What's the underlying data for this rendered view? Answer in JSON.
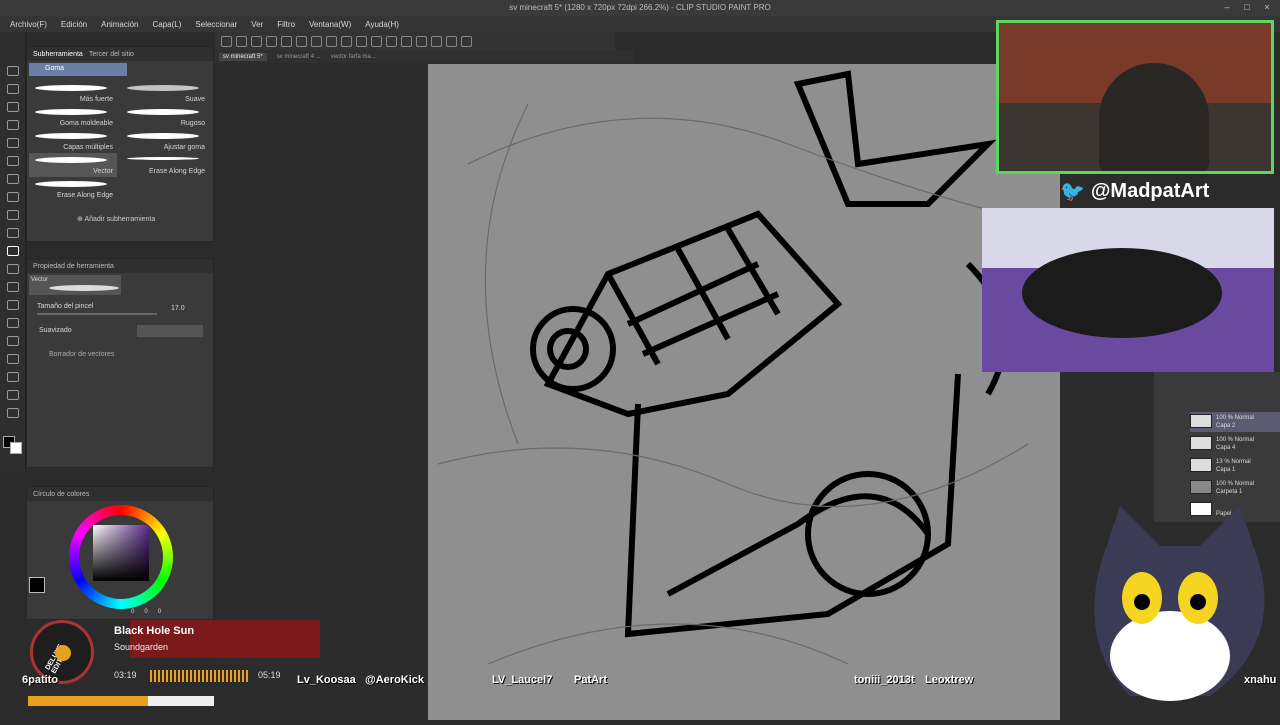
{
  "app": {
    "window_title": "sv minecraft 5* (1280 x 720px 72dpi 266.2%)  - CLIP STUDIO PAINT PRO"
  },
  "menu": [
    "Archivo(F)",
    "Edición",
    "Animación",
    "Capa(L)",
    "Seleccionar",
    "Ver",
    "Filtro",
    "Ventana(W)",
    "Ayuda(H)"
  ],
  "document_tabs": [
    "sv minecraft 5*",
    "sv minecraft 4 ...",
    "vector farfa ma..."
  ],
  "subtool_panel": {
    "tabs": [
      "Subherramienta",
      "Tercer del sitio"
    ],
    "group": "Goma",
    "brushes": [
      "Más fuerte",
      "Suave",
      "Goma moldeable",
      "Rugoso",
      "Capas múltiples",
      "Ajustar goma",
      "Vector",
      "Erase Along Edge",
      "Erase Along Edge"
    ],
    "add_label": "Añadir subherramienta"
  },
  "tool_property": {
    "title": "Propiedad de herramienta",
    "tag": "Vector",
    "brush_size_label": "Tamaño del pincel",
    "brush_size_value": "17.0",
    "smoothing_label": "Suavizado",
    "vector_eraser_label": "Borrador de vectores"
  },
  "color_panel": {
    "title": "Círculo de colores",
    "rgb": [
      "0",
      "0",
      "0"
    ],
    "accent": "#5b2a8a"
  },
  "overlay": {
    "handle": "@MadpatArt",
    "song_title": "Black Hole Sun",
    "song_artist": "Soundgarden",
    "time_elapsed": "03:19",
    "time_total": "05:19",
    "chat_names": [
      "6patito",
      "Lv_Koosaa",
      "@AeroKick",
      "LV_Laucel7",
      "PatArt",
      "toniii_2013t",
      "Leoxtrew",
      "xnahu"
    ],
    "record_badge": "DELUXE EDITION"
  },
  "layers": [
    {
      "blend": "100 % Normal",
      "name": "Capa 2"
    },
    {
      "blend": "100 % Normal",
      "name": "Capa 4"
    },
    {
      "blend": "13 % Normal",
      "name": "Capa 1"
    },
    {
      "blend": "100 % Normal",
      "name": "Carpeta 1"
    },
    {
      "blend": "",
      "name": "Papel"
    }
  ]
}
